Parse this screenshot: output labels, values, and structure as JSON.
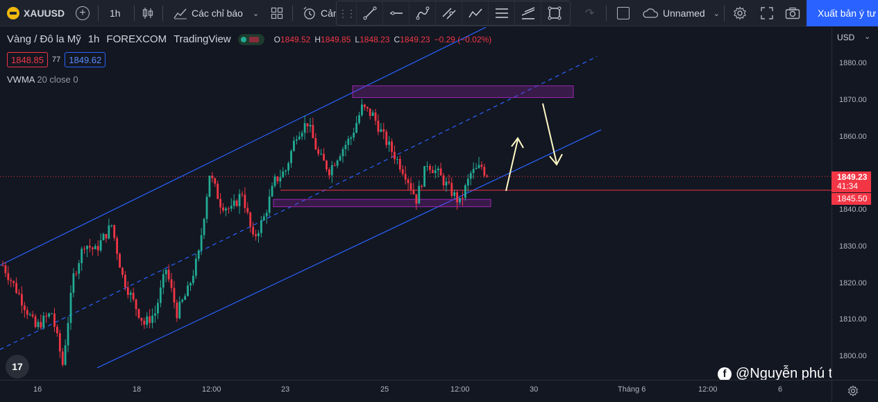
{
  "toolbar": {
    "symbol": "XAUUSD",
    "interval": "1h",
    "indicators_label": "Các chỉ báo",
    "alert_label": "Cản",
    "layout_name": "Unnamed",
    "publish_label": "Xuất bản ý tư"
  },
  "legend": {
    "title": "Vàng / Đô la Mỹ",
    "interval": "1h",
    "exchange": "FOREXCOM",
    "source": "TradingView",
    "ohlc": [
      {
        "k": "O",
        "v": "1849.52"
      },
      {
        "k": "H",
        "v": "1849.85"
      },
      {
        "k": "L",
        "v": "1848.23"
      },
      {
        "k": "C",
        "v": "1849.23"
      },
      {
        "k": "",
        "v": "−0.29 (−0.02%)"
      }
    ],
    "sell_price": "1848.85",
    "spread": "77",
    "buy_price": "1849.62",
    "indicator_name": "VWMA",
    "indicator_params": "20 close 0"
  },
  "price_axis": {
    "currency": "USD",
    "ticks": [
      "1880.00",
      "1870.00",
      "1860.00",
      "1850.00",
      "1840.00",
      "1830.00",
      "1820.00",
      "1810.00",
      "1800.00"
    ],
    "current_price": "1849.23",
    "countdown": "41:34",
    "line_price": "1845.50"
  },
  "time_axis": {
    "ticks": [
      "16",
      "18",
      "12:00",
      "23",
      "25",
      "12:00",
      "30",
      "Tháng 6",
      "12:00",
      "6"
    ]
  },
  "watermark": {
    "text": "@Nguyễn phú tùng"
  },
  "tv_logo": "17",
  "colors": {
    "up": "#22ab94",
    "down": "#f23645",
    "channel": "#2962ff",
    "zone": "#9c27b0",
    "arrows": "#fff9c4",
    "background": "#131722"
  },
  "chart_data": {
    "type": "candlestick",
    "title": "Vàng / Đô la Mỹ",
    "ylim": [
      1797,
      1888
    ],
    "y_ticks": [
      1800,
      1810,
      1820,
      1830,
      1840,
      1850,
      1860,
      1870,
      1880
    ],
    "x_ticks": [
      "16",
      "18",
      "12:00",
      "23",
      "25",
      "12:00",
      "30",
      "Tháng 6",
      "12:00",
      "6"
    ],
    "close_path": [
      [
        0,
        1825
      ],
      [
        6,
        1817
      ],
      [
        12,
        1808
      ],
      [
        18,
        1812
      ],
      [
        22,
        1798
      ],
      [
        26,
        1822
      ],
      [
        30,
        1831
      ],
      [
        34,
        1829
      ],
      [
        40,
        1836
      ],
      [
        44,
        1822
      ],
      [
        48,
        1815
      ],
      [
        52,
        1809
      ],
      [
        56,
        1812
      ],
      [
        60,
        1824
      ],
      [
        64,
        1812
      ],
      [
        68,
        1818
      ],
      [
        72,
        1828
      ],
      [
        76,
        1850
      ],
      [
        80,
        1842
      ],
      [
        84,
        1840
      ],
      [
        88,
        1845
      ],
      [
        92,
        1832
      ],
      [
        96,
        1838
      ],
      [
        100,
        1848
      ],
      [
        104,
        1851
      ],
      [
        108,
        1861
      ],
      [
        112,
        1864
      ],
      [
        116,
        1855
      ],
      [
        120,
        1851
      ],
      [
        124,
        1856
      ],
      [
        128,
        1860
      ],
      [
        132,
        1868
      ],
      [
        136,
        1866
      ],
      [
        140,
        1860
      ],
      [
        144,
        1855
      ],
      [
        148,
        1850
      ],
      [
        152,
        1843
      ],
      [
        156,
        1853
      ],
      [
        160,
        1850
      ],
      [
        164,
        1846
      ],
      [
        168,
        1842
      ],
      [
        172,
        1850
      ],
      [
        176,
        1852
      ],
      [
        178,
        1849.23
      ]
    ],
    "current_price": 1849.23,
    "horizontal_line": 1845.5
  }
}
